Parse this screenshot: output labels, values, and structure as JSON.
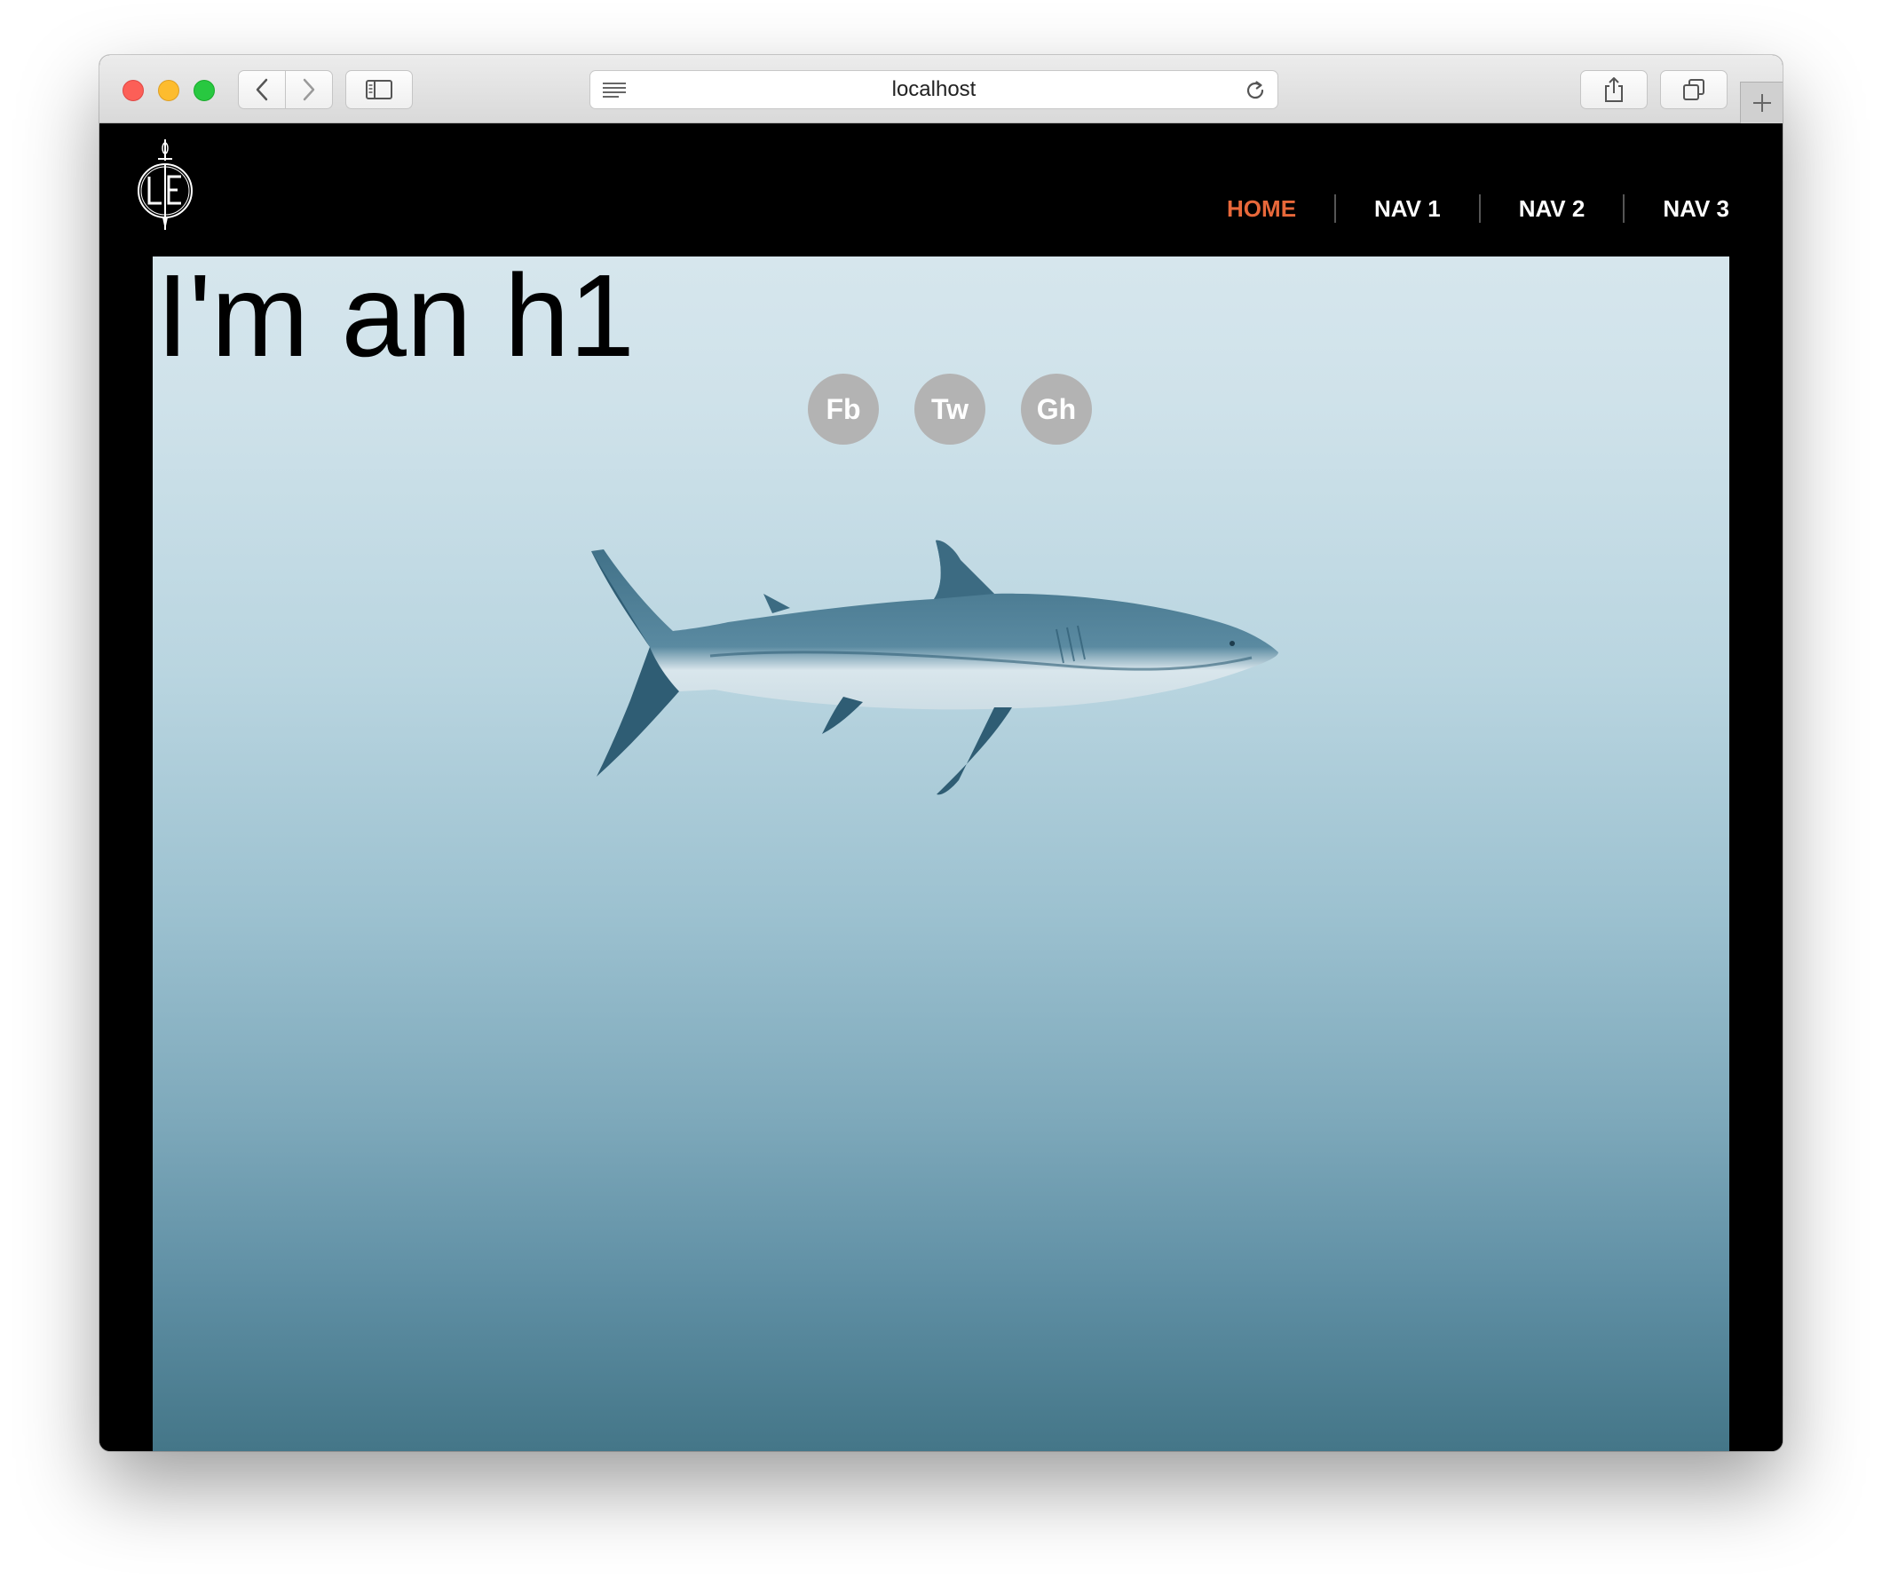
{
  "browser": {
    "url": "localhost",
    "icons": [
      "back-icon",
      "forward-icon",
      "sidebar-icon",
      "reader-icon",
      "reload-icon",
      "share-icon",
      "tabs-icon",
      "plus-icon"
    ]
  },
  "site": {
    "logo_icon": "le-dagger-logo-icon",
    "nav": [
      {
        "label": "HOME",
        "active": true
      },
      {
        "label": "NAV 1",
        "active": false
      },
      {
        "label": "NAV 2",
        "active": false
      },
      {
        "label": "NAV 3",
        "active": false
      }
    ],
    "active_color": "#e8683a",
    "hero": {
      "heading": "I'm an h1",
      "socials": [
        {
          "label": "Fb"
        },
        {
          "label": "Tw"
        },
        {
          "label": "Gh"
        }
      ],
      "image": "shark-image"
    }
  }
}
